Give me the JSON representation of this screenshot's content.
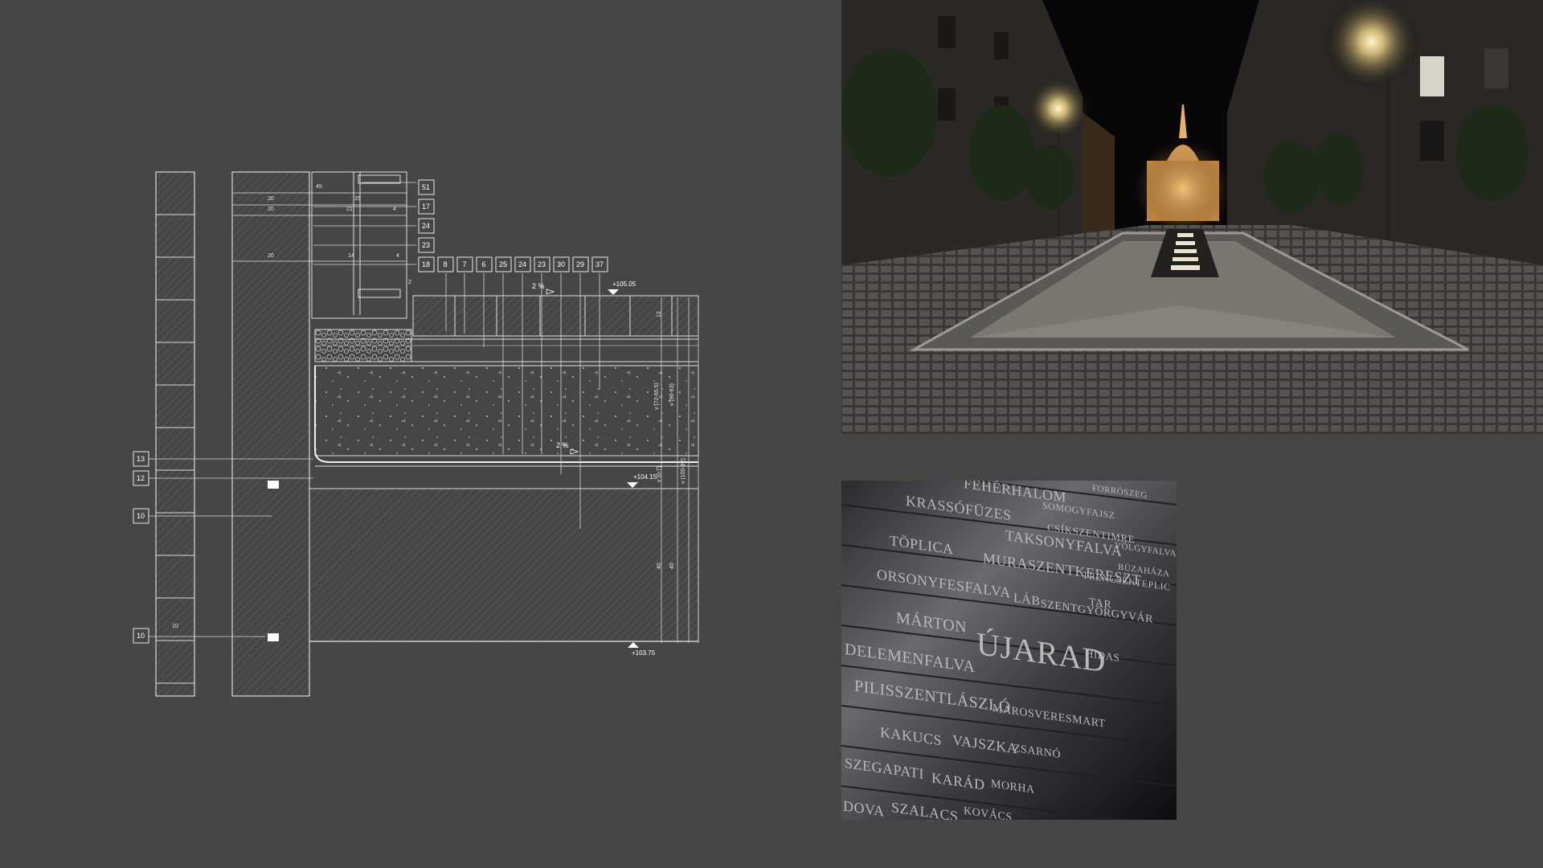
{
  "colors": {
    "background": "#464646",
    "line": "#e8e8e8",
    "hatch": "#8a8a8a"
  },
  "drawing": {
    "callouts_top": [
      "51",
      "17",
      "24",
      "23"
    ],
    "callouts_row": [
      "18",
      "8",
      "7",
      "6",
      "25",
      "24",
      "23",
      "30",
      "29",
      "37"
    ],
    "callouts_left": [
      "13",
      "12",
      "10",
      "10"
    ],
    "slope_upper": "2 %",
    "slope_lower": "2 %",
    "level_top": "+105.05",
    "level_mid": "+104.15",
    "level_bottom": "+103.75",
    "dims_top": [
      "45",
      "25",
      "20",
      "20",
      "21",
      "4",
      "20",
      "14",
      "4",
      "2"
    ],
    "dim_left_bottom": "10",
    "dims_vertical": [
      "v (72-65.5)",
      "v (90-63)",
      "v (0-7)",
      "v (100-92)",
      "40",
      "40",
      "12"
    ]
  },
  "photos": {
    "street_icon": "night-street-photo",
    "wall_icon": "engraved-names-wall-photo",
    "wall_words": [
      "FEHÉRHALOM",
      "KRASSÓFÜZES",
      "SOMOGYFAJSZ",
      "CSÍKSZENTIMRE",
      "FORRÓSZEG",
      "TAKSONYFALVA",
      "VÖLGYFALVA",
      "TÖPLICA",
      "MURASZENTKERESZT",
      "BÚZAHÁZA",
      "ORSONYFESFALVA",
      "TRENCSÉNTEPLIC",
      "LÁB",
      "TAR",
      "SZENTGYÖRGYVÁR",
      "MÁRTON",
      "ÚJARAD",
      "DELEMENFALVA",
      "HIDAS",
      "PILISSZENTLÁSZLÓ",
      "MAROSVERESMART",
      "KAKUCS",
      "VAJSZKA",
      "ZSARNÓ",
      "SZEGAPATI",
      "KARÁD",
      "MORHA",
      "DOVA",
      "SZALACS",
      "KOVÁCS"
    ]
  }
}
